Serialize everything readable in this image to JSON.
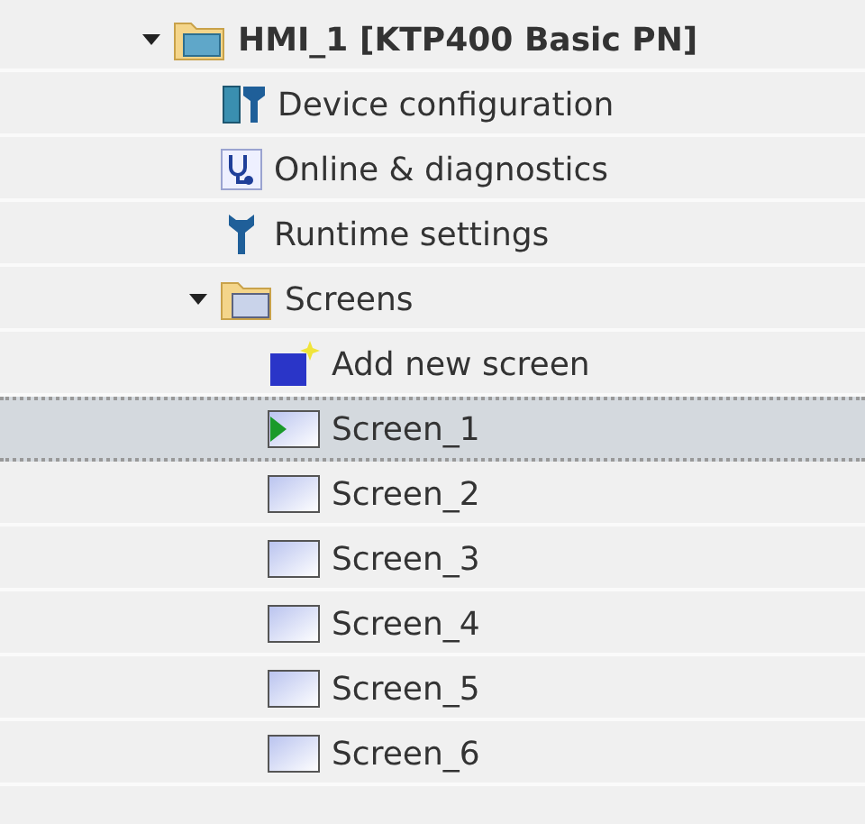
{
  "tree": [
    {
      "label": "HMI_1 [KTP400 Basic PN]",
      "kind": "device",
      "expanded": true,
      "selected": false,
      "children": [
        {
          "label": "Device configuration",
          "kind": "config",
          "selected": false
        },
        {
          "label": "Online & diagnostics",
          "kind": "diagnostics",
          "selected": false
        },
        {
          "label": "Runtime settings",
          "kind": "settings",
          "selected": false
        },
        {
          "label": "Screens",
          "kind": "folder",
          "expanded": true,
          "selected": false,
          "children": [
            {
              "label": "Add new screen",
              "kind": "add",
              "selected": false
            },
            {
              "label": "Screen_1",
              "kind": "start-screen",
              "selected": true
            },
            {
              "label": "Screen_2",
              "kind": "screen",
              "selected": false
            },
            {
              "label": "Screen_3",
              "kind": "screen",
              "selected": false
            },
            {
              "label": "Screen_4",
              "kind": "screen",
              "selected": false
            },
            {
              "label": "Screen_5",
              "kind": "screen",
              "selected": false
            },
            {
              "label": "Screen_6",
              "kind": "screen",
              "selected": false
            }
          ]
        }
      ]
    }
  ]
}
